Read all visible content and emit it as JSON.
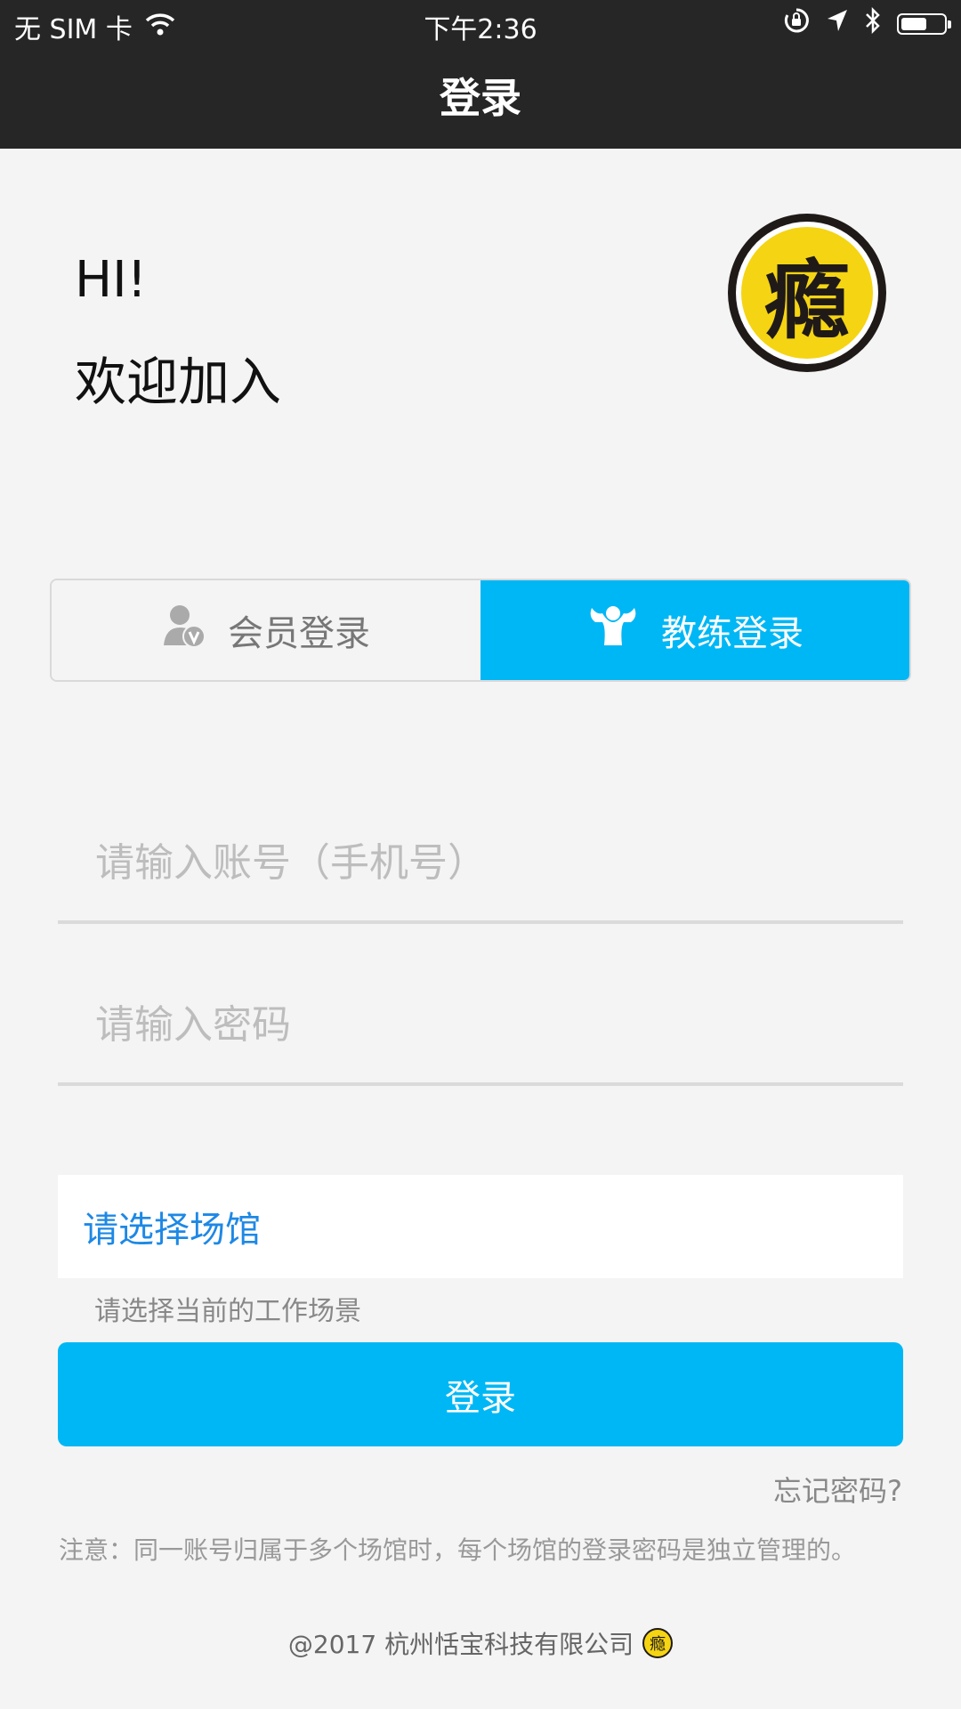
{
  "status_bar": {
    "carrier": "无 SIM 卡",
    "time": "下午2:36",
    "battery_level": 0.6,
    "icons": [
      "wifi-icon",
      "orientation-lock-icon",
      "location-arrow-icon",
      "bluetooth-icon",
      "battery-icon"
    ]
  },
  "nav": {
    "title": "登录"
  },
  "welcome": {
    "hi": "HI!",
    "subtitle": "欢迎加入"
  },
  "logo": {
    "glyph": "瘾",
    "colors": {
      "ring": "#1f1a18",
      "fill": "#f5d413"
    }
  },
  "tabs": [
    {
      "label": "会员登录",
      "icon": "member-icon",
      "active": false
    },
    {
      "label": "教练登录",
      "icon": "coach-icon",
      "active": true
    }
  ],
  "form": {
    "account": {
      "value": "",
      "placeholder": "请输入账号（手机号）"
    },
    "password": {
      "value": "",
      "placeholder": "请输入密码"
    },
    "venue": {
      "label": "请选择场馆",
      "hint": "请选择当前的工作场景"
    }
  },
  "login_button": "登录",
  "forgot_password": "忘记密码?",
  "notice": "注意：同一账号归属于多个场馆时，每个场馆的登录密码是独立管理的。",
  "footer": {
    "copyright": "@2017  杭州恬宝科技有限公司"
  },
  "colors": {
    "accent": "#00b7f5",
    "link": "#1e88e5",
    "header": "#262626"
  }
}
